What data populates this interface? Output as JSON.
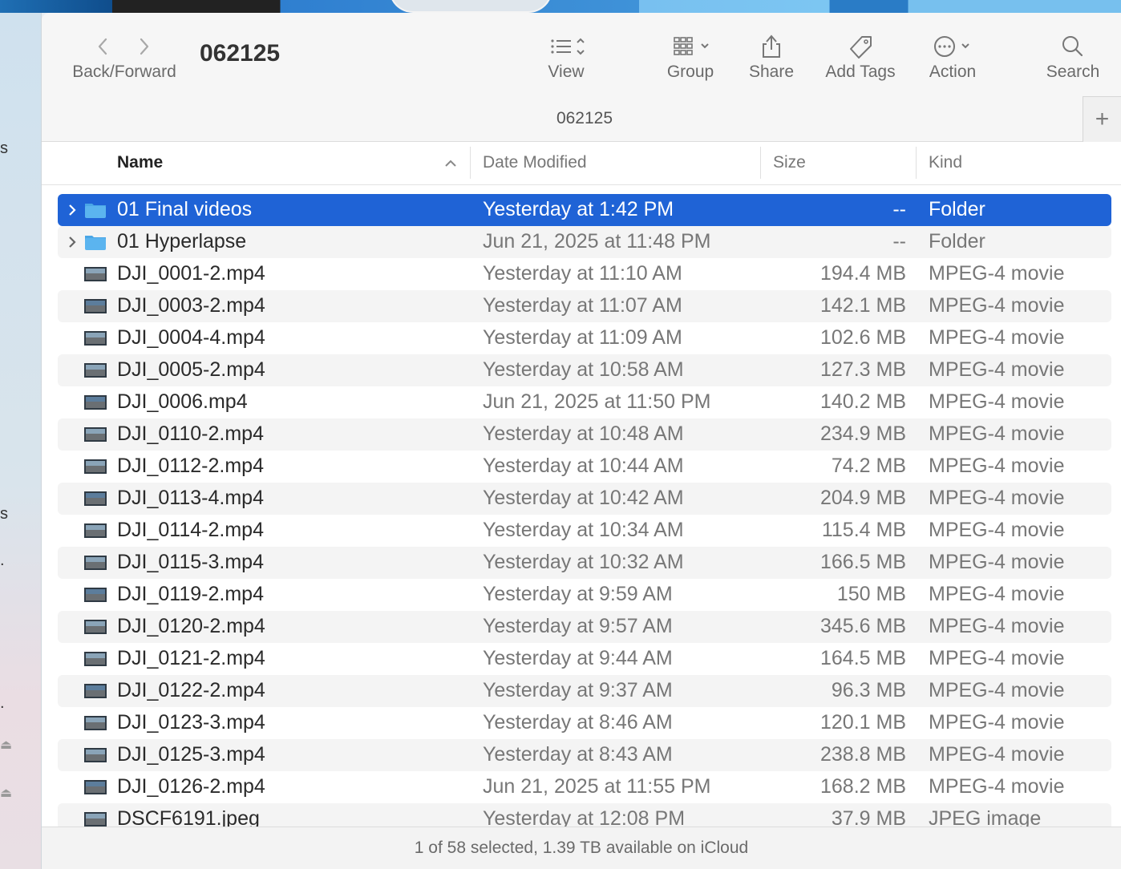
{
  "window": {
    "title": "062125",
    "path_title": "062125"
  },
  "toolbar": {
    "back_forward_label": "Back/Forward",
    "view_label": "View",
    "group_label": "Group",
    "share_label": "Share",
    "add_tags_label": "Add Tags",
    "action_label": "Action",
    "search_label": "Search",
    "new_tab_symbol": "+"
  },
  "columns": {
    "name": "Name",
    "date_modified": "Date Modified",
    "size": "Size",
    "kind": "Kind"
  },
  "rows": [
    {
      "name": "01 Final videos",
      "date": "Yesterday at 1:42 PM",
      "size": "--",
      "kind": "Folder",
      "type": "folder",
      "selected": true
    },
    {
      "name": "01 Hyperlapse",
      "date": "Jun 21, 2025 at 11:48 PM",
      "size": "--",
      "kind": "Folder",
      "type": "folder"
    },
    {
      "name": "DJI_0001-2.mp4",
      "date": "Yesterday at 11:10 AM",
      "size": "194.4 MB",
      "kind": "MPEG-4 movie",
      "type": "video"
    },
    {
      "name": "DJI_0003-2.mp4",
      "date": "Yesterday at 11:07 AM",
      "size": "142.1 MB",
      "kind": "MPEG-4 movie",
      "type": "video"
    },
    {
      "name": "DJI_0004-4.mp4",
      "date": "Yesterday at 11:09 AM",
      "size": "102.6 MB",
      "kind": "MPEG-4 movie",
      "type": "video"
    },
    {
      "name": "DJI_0005-2.mp4",
      "date": "Yesterday at 10:58 AM",
      "size": "127.3 MB",
      "kind": "MPEG-4 movie",
      "type": "video"
    },
    {
      "name": "DJI_0006.mp4",
      "date": "Jun 21, 2025 at 11:50 PM",
      "size": "140.2 MB",
      "kind": "MPEG-4 movie",
      "type": "video"
    },
    {
      "name": "DJI_0110-2.mp4",
      "date": "Yesterday at 10:48 AM",
      "size": "234.9 MB",
      "kind": "MPEG-4 movie",
      "type": "video"
    },
    {
      "name": "DJI_0112-2.mp4",
      "date": "Yesterday at 10:44 AM",
      "size": "74.2 MB",
      "kind": "MPEG-4 movie",
      "type": "video"
    },
    {
      "name": "DJI_0113-4.mp4",
      "date": "Yesterday at 10:42 AM",
      "size": "204.9 MB",
      "kind": "MPEG-4 movie",
      "type": "video"
    },
    {
      "name": "DJI_0114-2.mp4",
      "date": "Yesterday at 10:34 AM",
      "size": "115.4 MB",
      "kind": "MPEG-4 movie",
      "type": "video"
    },
    {
      "name": "DJI_0115-3.mp4",
      "date": "Yesterday at 10:32 AM",
      "size": "166.5 MB",
      "kind": "MPEG-4 movie",
      "type": "video"
    },
    {
      "name": "DJI_0119-2.mp4",
      "date": "Yesterday at 9:59 AM",
      "size": "150 MB",
      "kind": "MPEG-4 movie",
      "type": "video"
    },
    {
      "name": "DJI_0120-2.mp4",
      "date": "Yesterday at 9:57 AM",
      "size": "345.6 MB",
      "kind": "MPEG-4 movie",
      "type": "video"
    },
    {
      "name": "DJI_0121-2.mp4",
      "date": "Yesterday at 9:44 AM",
      "size": "164.5 MB",
      "kind": "MPEG-4 movie",
      "type": "video"
    },
    {
      "name": "DJI_0122-2.mp4",
      "date": "Yesterday at 9:37 AM",
      "size": "96.3 MB",
      "kind": "MPEG-4 movie",
      "type": "video"
    },
    {
      "name": "DJI_0123-3.mp4",
      "date": "Yesterday at 8:46 AM",
      "size": "120.1 MB",
      "kind": "MPEG-4 movie",
      "type": "video"
    },
    {
      "name": "DJI_0125-3.mp4",
      "date": "Yesterday at 8:43 AM",
      "size": "238.8 MB",
      "kind": "MPEG-4 movie",
      "type": "video"
    },
    {
      "name": "DJI_0126-2.mp4",
      "date": "Jun 21, 2025 at 11:55 PM",
      "size": "168.2 MB",
      "kind": "MPEG-4 movie",
      "type": "video"
    },
    {
      "name": "DSCF6191.jpeg",
      "date": "Yesterday at 12:08 PM",
      "size": "37.9 MB",
      "kind": "JPEG image",
      "type": "image"
    }
  ],
  "status": {
    "text": "1 of 58 selected, 1.39 TB available on iCloud"
  },
  "colors": {
    "selection": "#1f63d6",
    "folder": "#5bb4ef"
  }
}
